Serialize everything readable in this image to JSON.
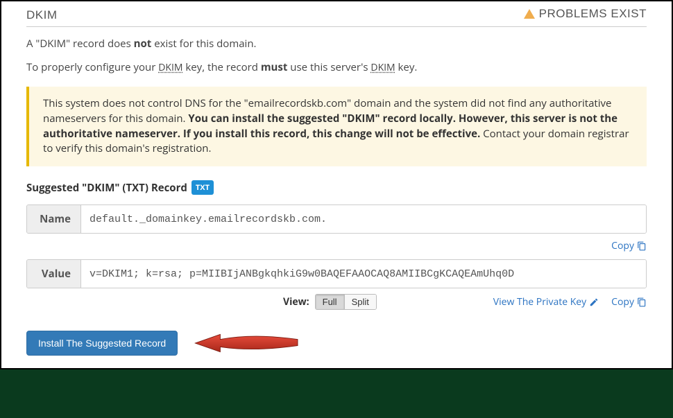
{
  "header": {
    "title": "DKIM",
    "status": "PROBLEMS EXIST"
  },
  "messages": {
    "line1_pre": "A \"DKIM\" record does ",
    "line1_bold": "not",
    "line1_post": " exist for this domain.",
    "line2_pre": "To properly configure your ",
    "line2_kw1": "DKIM",
    "line2_mid": " key, the record ",
    "line2_bold": "must",
    "line2_post1": " use this server's ",
    "line2_kw2": "DKIM",
    "line2_post2": " key."
  },
  "callout": {
    "part1": "This system does not control DNS for the \"emailrecordskb.com\" domain and the system did not find any authoritative nameservers for this domain. ",
    "bold": "You can install the suggested \"DKIM\" record locally. However, this server is not the authoritative nameserver. If you install this record, this change will not be effective.",
    "part2": " Contact your domain registrar to verify this domain's registration."
  },
  "suggested": {
    "label": "Suggested \"DKIM\" (TXT) Record",
    "badge": "TXT"
  },
  "fields": {
    "name_label": "Name",
    "name_value": "default._domainkey.emailrecordskb.com.",
    "value_label": "Value",
    "value_value": "v=DKIM1; k=rsa; p=MIIBIjANBgkqhkiG9w0BAQEFAAOCAQ8AMIIBCgKCAQEAmUhq0D"
  },
  "actions": {
    "copy": "Copy",
    "view_label": "View:",
    "view_full": "Full",
    "view_split": "Split",
    "view_private_key": "View The Private Key"
  },
  "install": {
    "button": "Install The Suggested Record"
  }
}
